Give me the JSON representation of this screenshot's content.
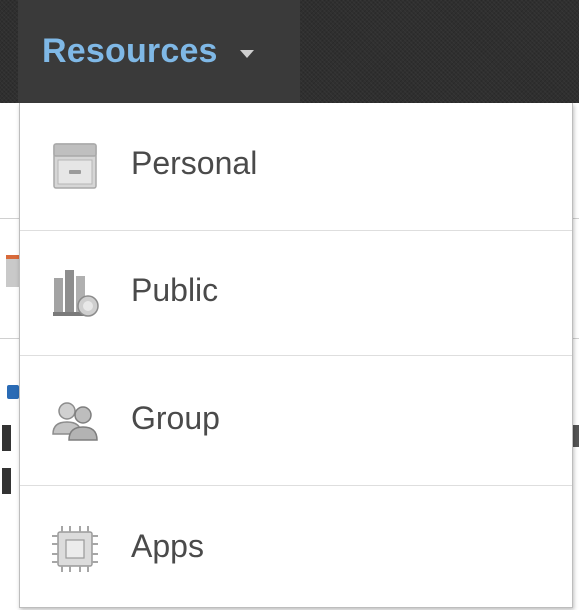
{
  "navbar": {
    "resources_label": "Resources",
    "accent_color": "#7fb8e6"
  },
  "menu": {
    "items": [
      {
        "label": "Personal",
        "icon": "drawer-icon"
      },
      {
        "label": "Public",
        "icon": "library-icon"
      },
      {
        "label": "Group",
        "icon": "users-icon"
      },
      {
        "label": "Apps",
        "icon": "apps-icon"
      }
    ]
  }
}
